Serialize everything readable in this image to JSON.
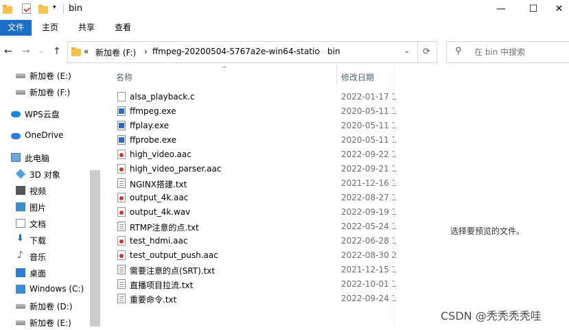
{
  "window": {
    "title": "bin",
    "controls": {
      "minimize": "—",
      "maximize": "☐",
      "close": "✕"
    }
  },
  "ribbon": {
    "tabs": [
      "文件",
      "主页",
      "共享",
      "查看"
    ]
  },
  "address": {
    "crumbs": [
      "«",
      "新加卷 (F:)",
      "›",
      "ffmpeg-20200504-5767a2e-win64-static",
      "›",
      "bin"
    ],
    "search_placeholder": "在 bin 中搜索"
  },
  "nav_pane": [
    {
      "label": "新加卷 (E:)",
      "icon": "drive-icon"
    },
    {
      "label": "新加卷 (F:)",
      "icon": "drive-icon"
    },
    {
      "label": "WPS云盘",
      "icon": "cloud-icon"
    },
    {
      "label": "OneDrive",
      "icon": "onedrive-icon"
    },
    {
      "label": "此电脑",
      "icon": "computer-icon"
    },
    {
      "label": "3D 对象",
      "icon": "cube-icon"
    },
    {
      "label": "视频",
      "icon": "video-icon"
    },
    {
      "label": "图片",
      "icon": "picture-icon"
    },
    {
      "label": "文档",
      "icon": "document-icon"
    },
    {
      "label": "下载",
      "icon": "download-icon"
    },
    {
      "label": "音乐",
      "icon": "music-icon"
    },
    {
      "label": "桌面",
      "icon": "desktop-icon"
    },
    {
      "label": "Windows (C:)",
      "icon": "windows-drive-icon"
    },
    {
      "label": "新加卷 (D:)",
      "icon": "drive-icon"
    },
    {
      "label": "新加卷 (E:)",
      "icon": "drive-icon"
    }
  ],
  "columns": {
    "name": "名称",
    "modified": "修改日期"
  },
  "files": [
    {
      "name": "alsa_playback.c",
      "date": "2022-01-17 1",
      "type": "c"
    },
    {
      "name": "ffmpeg.exe",
      "date": "2020-05-11 1",
      "type": "exe"
    },
    {
      "name": "ffplay.exe",
      "date": "2020-05-11 1",
      "type": "exe"
    },
    {
      "name": "ffprobe.exe",
      "date": "2020-05-11 1",
      "type": "exe"
    },
    {
      "name": "high_video.aac",
      "date": "2022-09-22 1",
      "type": "media"
    },
    {
      "name": "high_video_parser.aac",
      "date": "2022-09-21 1",
      "type": "media"
    },
    {
      "name": "NGINX搭建.txt",
      "date": "2021-12-16 1",
      "type": "txt"
    },
    {
      "name": "output_4k.aac",
      "date": "2022-08-27 1",
      "type": "media"
    },
    {
      "name": "output_4k.wav",
      "date": "2022-09-19 1",
      "type": "media"
    },
    {
      "name": "RTMP注意的点.txt",
      "date": "2022-05-24 1",
      "type": "txt"
    },
    {
      "name": "test_hdmi.aac",
      "date": "2022-06-28 1",
      "type": "media"
    },
    {
      "name": "test_output_push.aac",
      "date": "2022-08-30 2",
      "type": "media"
    },
    {
      "name": "需要注意的点(SRT).txt",
      "date": "2021-12-15 1",
      "type": "txt"
    },
    {
      "name": "直播项目拉流.txt",
      "date": "2022-10-01 1",
      "type": "txt"
    },
    {
      "name": "重要命令.txt",
      "date": "2022-09-24 1",
      "type": "txt"
    }
  ],
  "preview": {
    "message": "选择要预览的文件。"
  },
  "watermark": "CSDN @秃秃秃秃哇"
}
